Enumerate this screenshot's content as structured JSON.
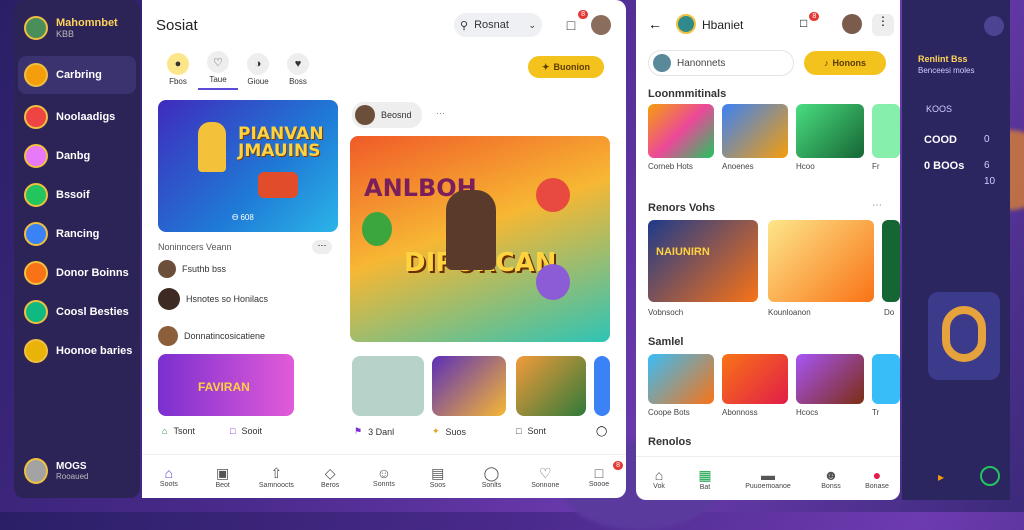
{
  "sidebar": {
    "brand_title": "Mahomnbet",
    "brand_sub": "KBB",
    "items": [
      {
        "label": "Carbring",
        "color": "#f59e0b"
      },
      {
        "label": "Noolaadigs",
        "color": "#ef4444"
      },
      {
        "label": "Danbg",
        "color": "#e879f9"
      },
      {
        "label": "Bssoif",
        "color": "#22c55e"
      },
      {
        "label": "Rancing",
        "color": "#3b82f6"
      },
      {
        "label": "Donor Boinns",
        "color": "#f97316"
      },
      {
        "label": "Coosl Besties",
        "color": "#10b981"
      },
      {
        "label": "Hoonoe baries",
        "color": "#eab308"
      }
    ],
    "footer_title": "MOGS",
    "footer_sub": "Rooaued"
  },
  "main": {
    "title": "Sosiat",
    "search": "Rosnat",
    "notif_badge": "8",
    "tabs": [
      "Fbos",
      "Taue",
      "Gioue",
      "Boss"
    ],
    "cta": "Buonion",
    "hero1_title": "PIANVAN JMAUINS",
    "hero1_caption": "Ɵ 608",
    "hero2_title": "ANLBOH",
    "hero2_sub": "DIPURCAN",
    "hero2_label": "Beosnd",
    "section_title": "Noninncers Veann",
    "list": [
      "Fsuthb bss",
      "Hsnotes so Honilacs",
      "Donnatincosicatiene"
    ],
    "hero3_title": "FAVIRAN",
    "actions": [
      "Tsont",
      "Sooit",
      "3 Danl",
      "Suos",
      "Sont"
    ],
    "nav": [
      "Soots",
      "Beot",
      "Samnoocts",
      "Beros",
      "Sonnts",
      "Soos",
      "Sonlts",
      "Sonnone",
      "Soooe"
    ],
    "nav_badge": "8"
  },
  "rpanel": {
    "title": "Hbaniet",
    "search": "Hanonnets",
    "cta": "Honons",
    "sec1": "Loonmmitinals",
    "sec1_caps": [
      "Corneb Hots",
      "Anoenes",
      "Hcoo",
      "Fr"
    ],
    "sec2": "Renors Vohs",
    "sec2_caps": [
      "Vobnsoch",
      "Kounloanon",
      "Do"
    ],
    "sec3": "Samlel",
    "sec3_caps": [
      "Coope Bots",
      "Abonnoss",
      "Hcocs",
      "Tr"
    ],
    "sec4": "Renolos",
    "nav": [
      "Vok",
      "Bat",
      "Puuoemoanoe",
      "Bonss",
      "Bonase"
    ]
  },
  "farright": {
    "title": "Renlint Bss",
    "sub": "Benceesi moles",
    "rows": [
      "KOOS",
      "COOD",
      "0 BOOs"
    ],
    "vals": [
      "0",
      "6",
      "10"
    ]
  }
}
